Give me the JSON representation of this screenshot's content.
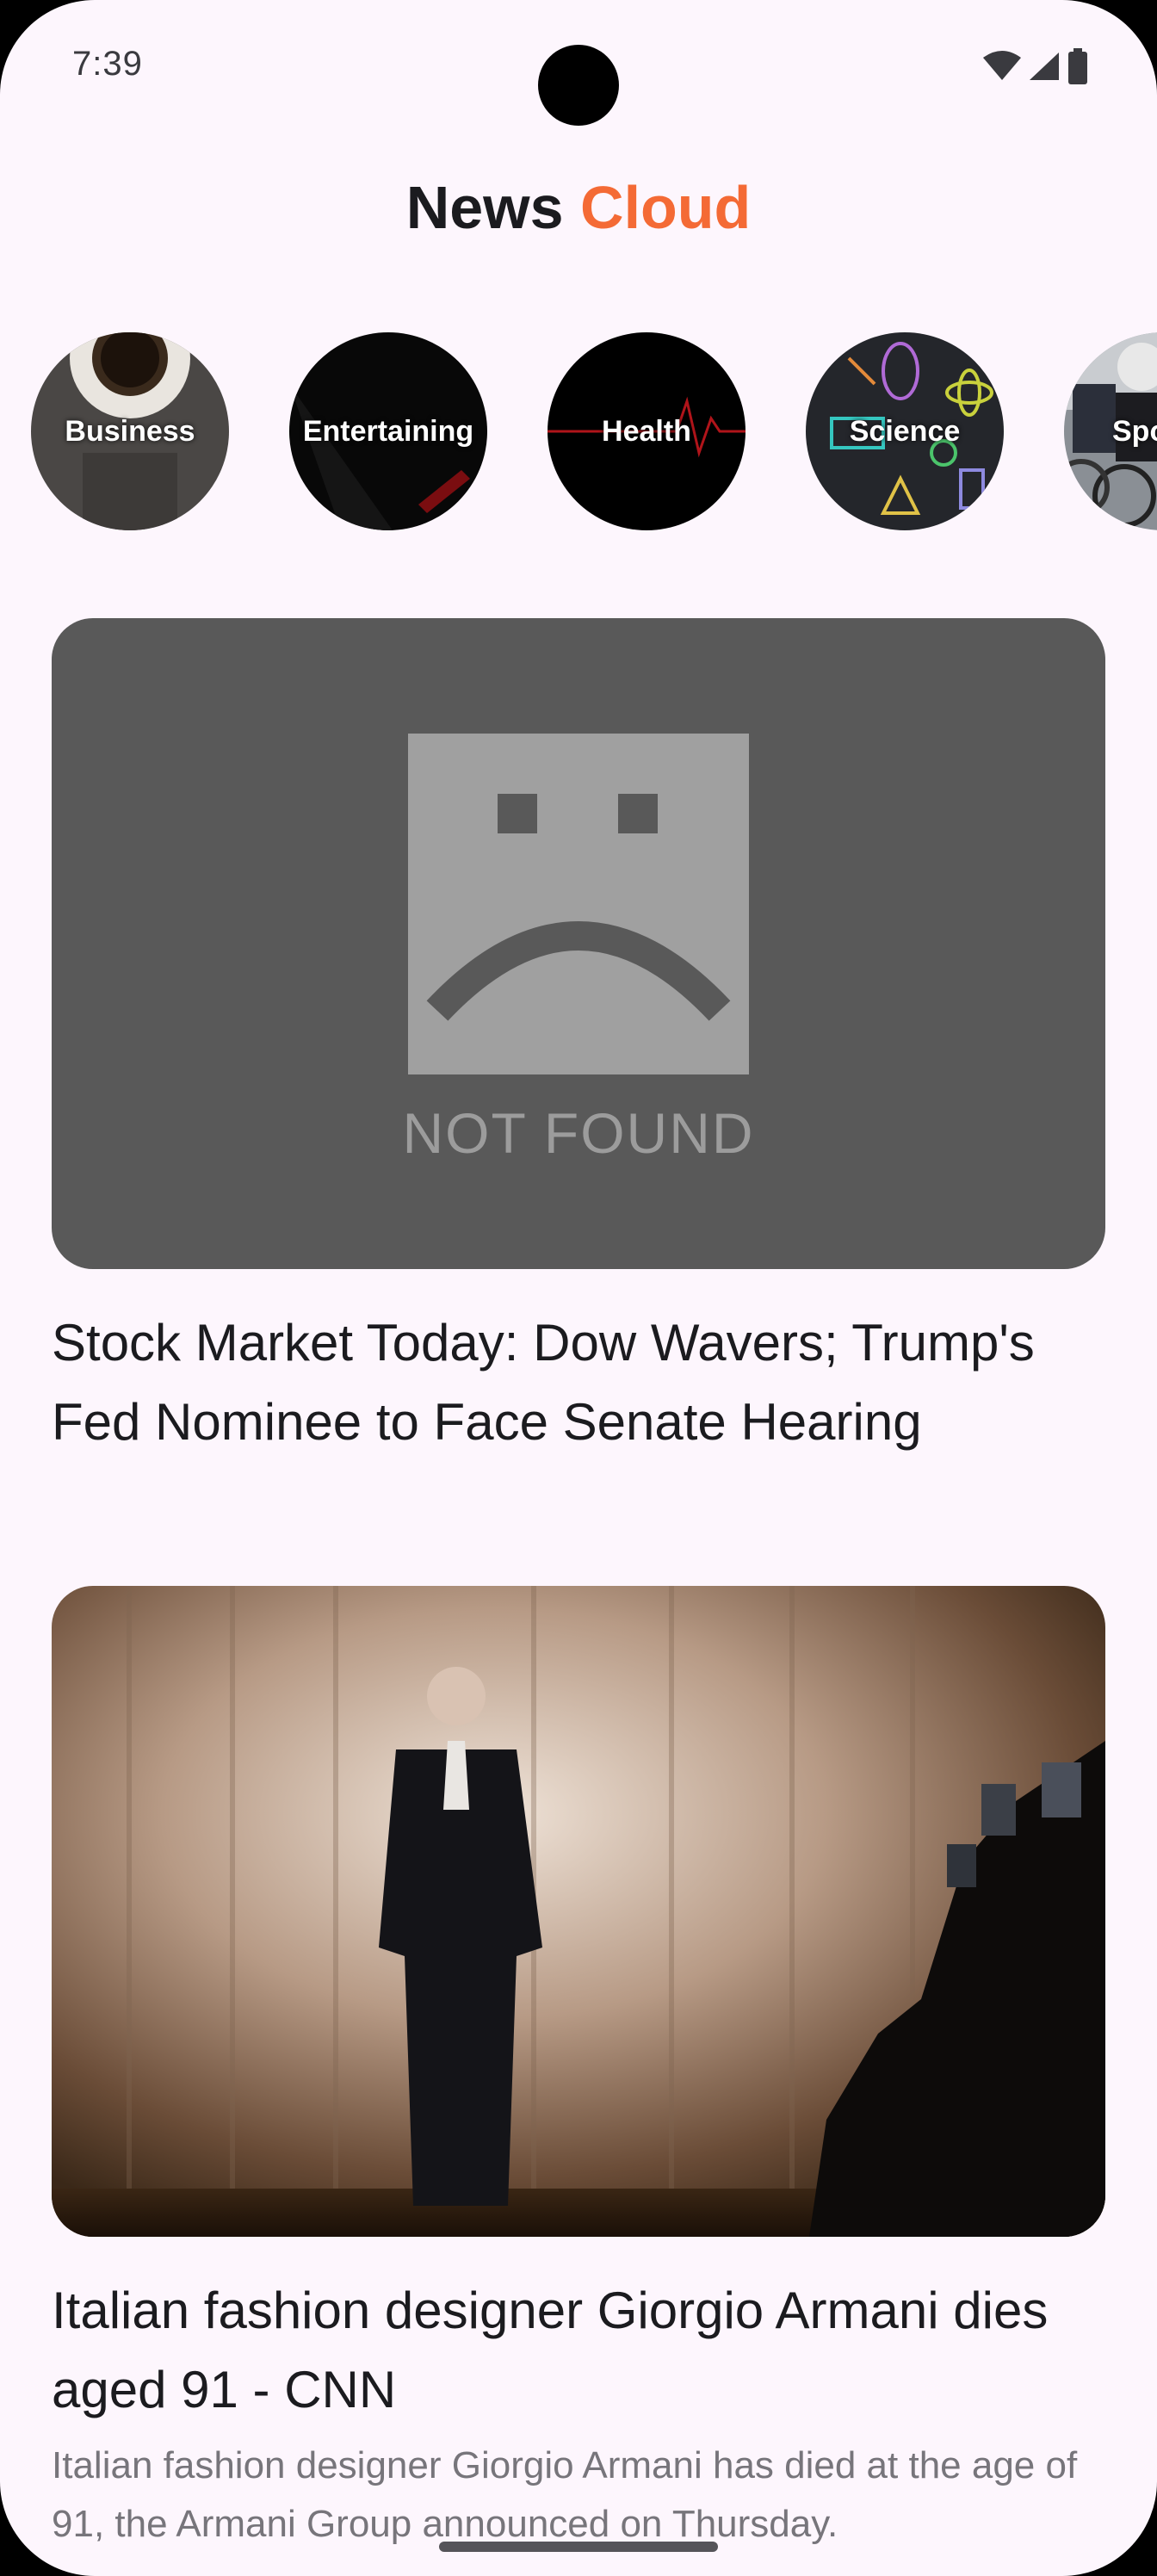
{
  "status_bar": {
    "time": "7:39",
    "icons": [
      "wifi-icon",
      "cellular-signal-icon",
      "battery-icon"
    ]
  },
  "app": {
    "title_part1": "News",
    "title_part2": "Cloud",
    "accent_color": "#f46a35"
  },
  "categories": [
    {
      "label": "Business"
    },
    {
      "label": "Entertaining"
    },
    {
      "label": "Health"
    },
    {
      "label": "Science"
    },
    {
      "label": "Sports"
    }
  ],
  "articles": [
    {
      "image_placeholder_text": "NOT FOUND",
      "title": "Stock Market Today: Dow Wavers; Trump's Fed Nominee to Face Senate Hearing",
      "description": ""
    },
    {
      "title": "Italian fashion designer Giorgio Armani dies aged 91 - CNN",
      "description": "Italian fashion designer Giorgio Armani has died at the age of 91, the Armani Group announced on Thursday."
    }
  ]
}
